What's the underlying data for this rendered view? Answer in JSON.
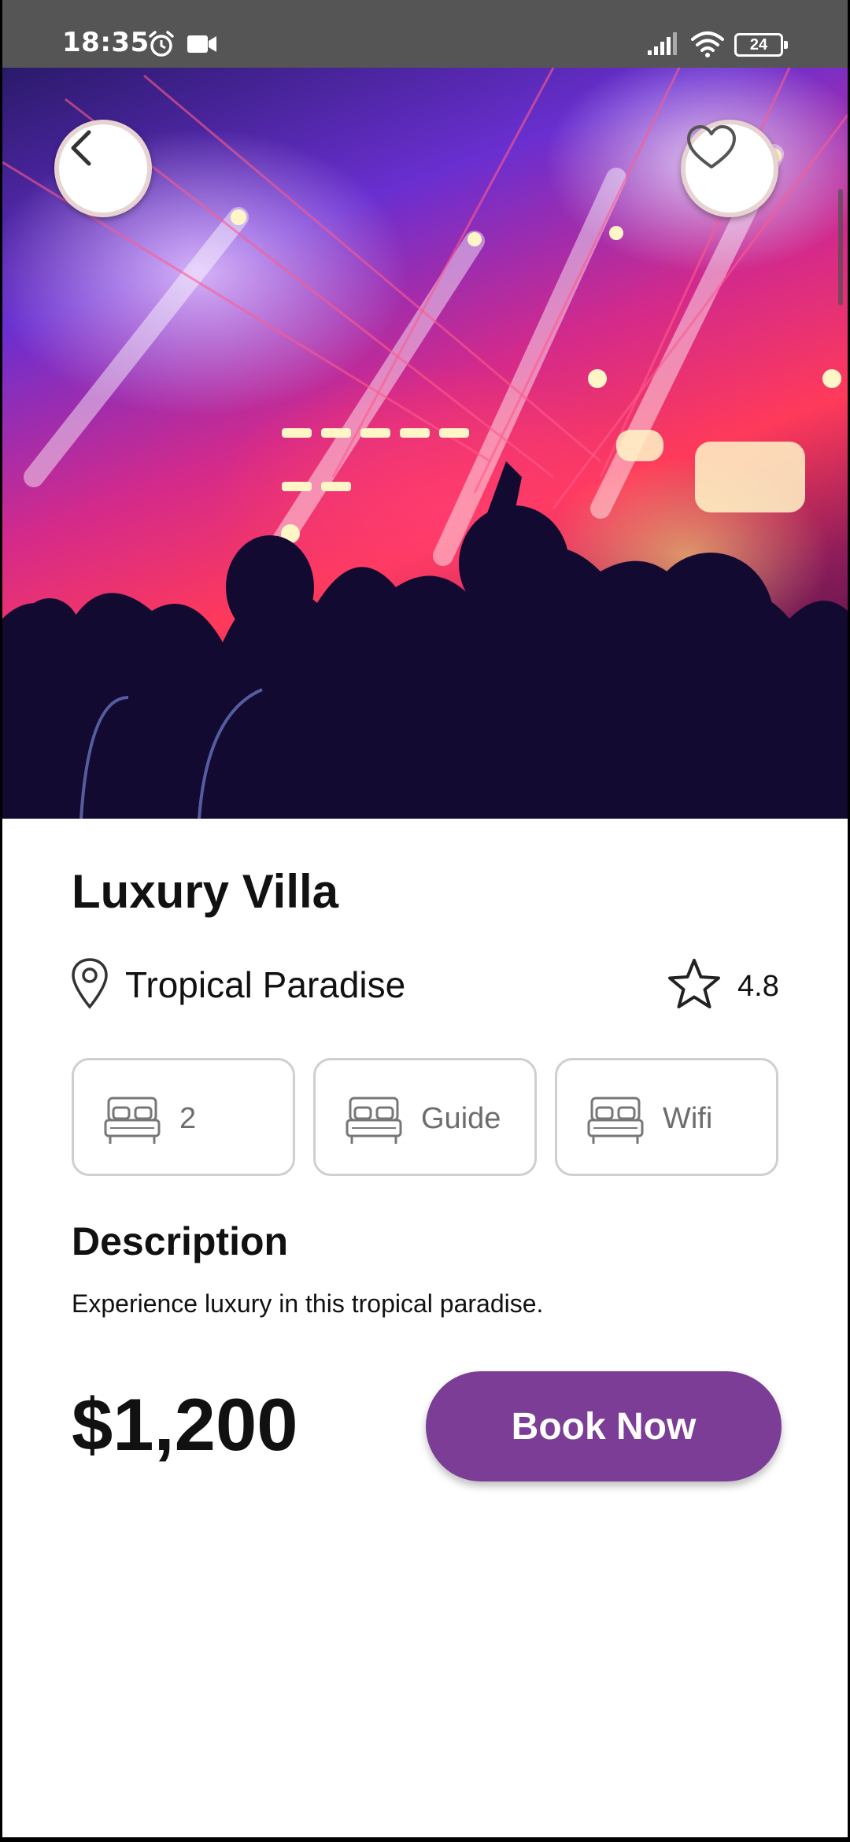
{
  "status_bar": {
    "time": "18:35",
    "battery": "24",
    "icons": [
      "alarm-icon",
      "video-camera-icon",
      "signal-icon",
      "wifi-icon",
      "battery-icon"
    ]
  },
  "hero": {
    "image": "concert-crowd-photo",
    "back_icon": "chevron-left-icon",
    "favorite_icon": "heart-outline-icon"
  },
  "property": {
    "title": "Luxury Villa",
    "location": "Tropical Paradise",
    "location_icon": "map-pin-icon",
    "rating": "4.8",
    "rating_icon": "star-outline-icon"
  },
  "features": [
    {
      "icon": "bed-icon",
      "label": "2"
    },
    {
      "icon": "bed-icon",
      "label": "Guide"
    },
    {
      "icon": "bed-icon",
      "label": "Wifi"
    }
  ],
  "description": {
    "heading": "Description",
    "text": "Experience luxury in this tropical paradise."
  },
  "booking": {
    "price": "$1,200",
    "button_label": "Book Now"
  },
  "colors": {
    "accent": "#7b3d95",
    "status_bar": "#555555",
    "chip_border": "#cfcfcf",
    "chip_text": "#6d6d6d"
  }
}
